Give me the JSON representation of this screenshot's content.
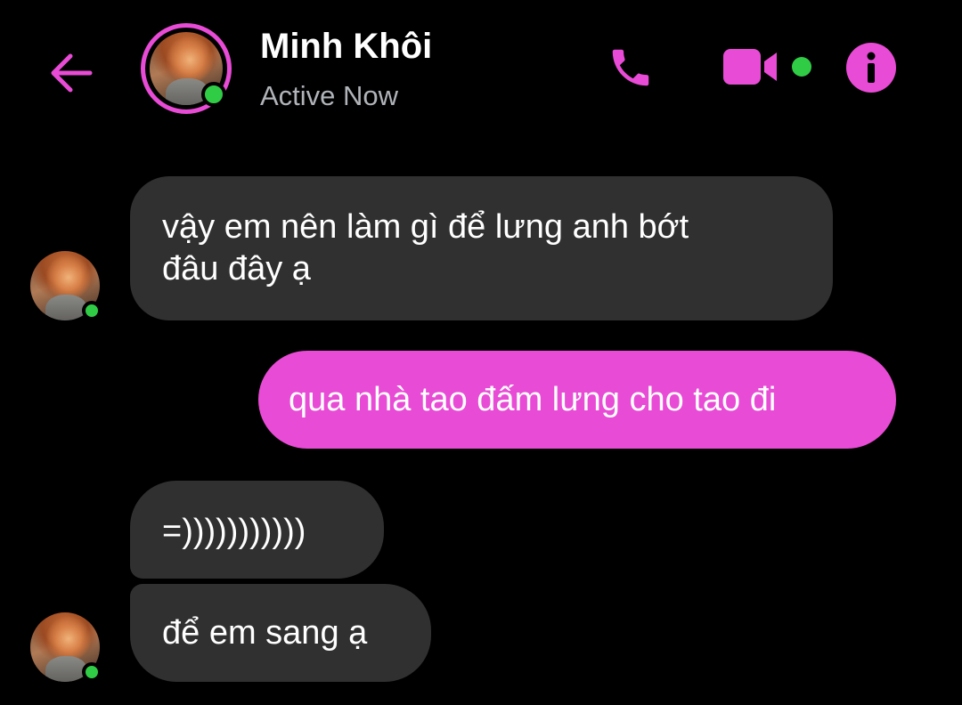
{
  "header": {
    "contact_name": "Minh Khôi",
    "status": "Active Now",
    "icons": {
      "back": "arrow-left-icon",
      "call": "phone-icon",
      "video": "video-camera-icon",
      "info": "info-icon"
    }
  },
  "messages": [
    {
      "direction": "incoming",
      "lines": [
        "vậy em nên làm gì để lưng anh bớt",
        "đâu đây ạ"
      ]
    },
    {
      "direction": "outgoing",
      "text": "qua nhà tao đấm lưng cho tao đi"
    },
    {
      "direction": "incoming",
      "text": "=)))))))))))"
    },
    {
      "direction": "incoming",
      "text": "để em sang ạ"
    }
  ],
  "colors": {
    "accent": "#E84BD5",
    "online": "#31CC46",
    "incoming_bubble": "#303030",
    "background": "#000000",
    "status_text": "#B0B3B8"
  }
}
